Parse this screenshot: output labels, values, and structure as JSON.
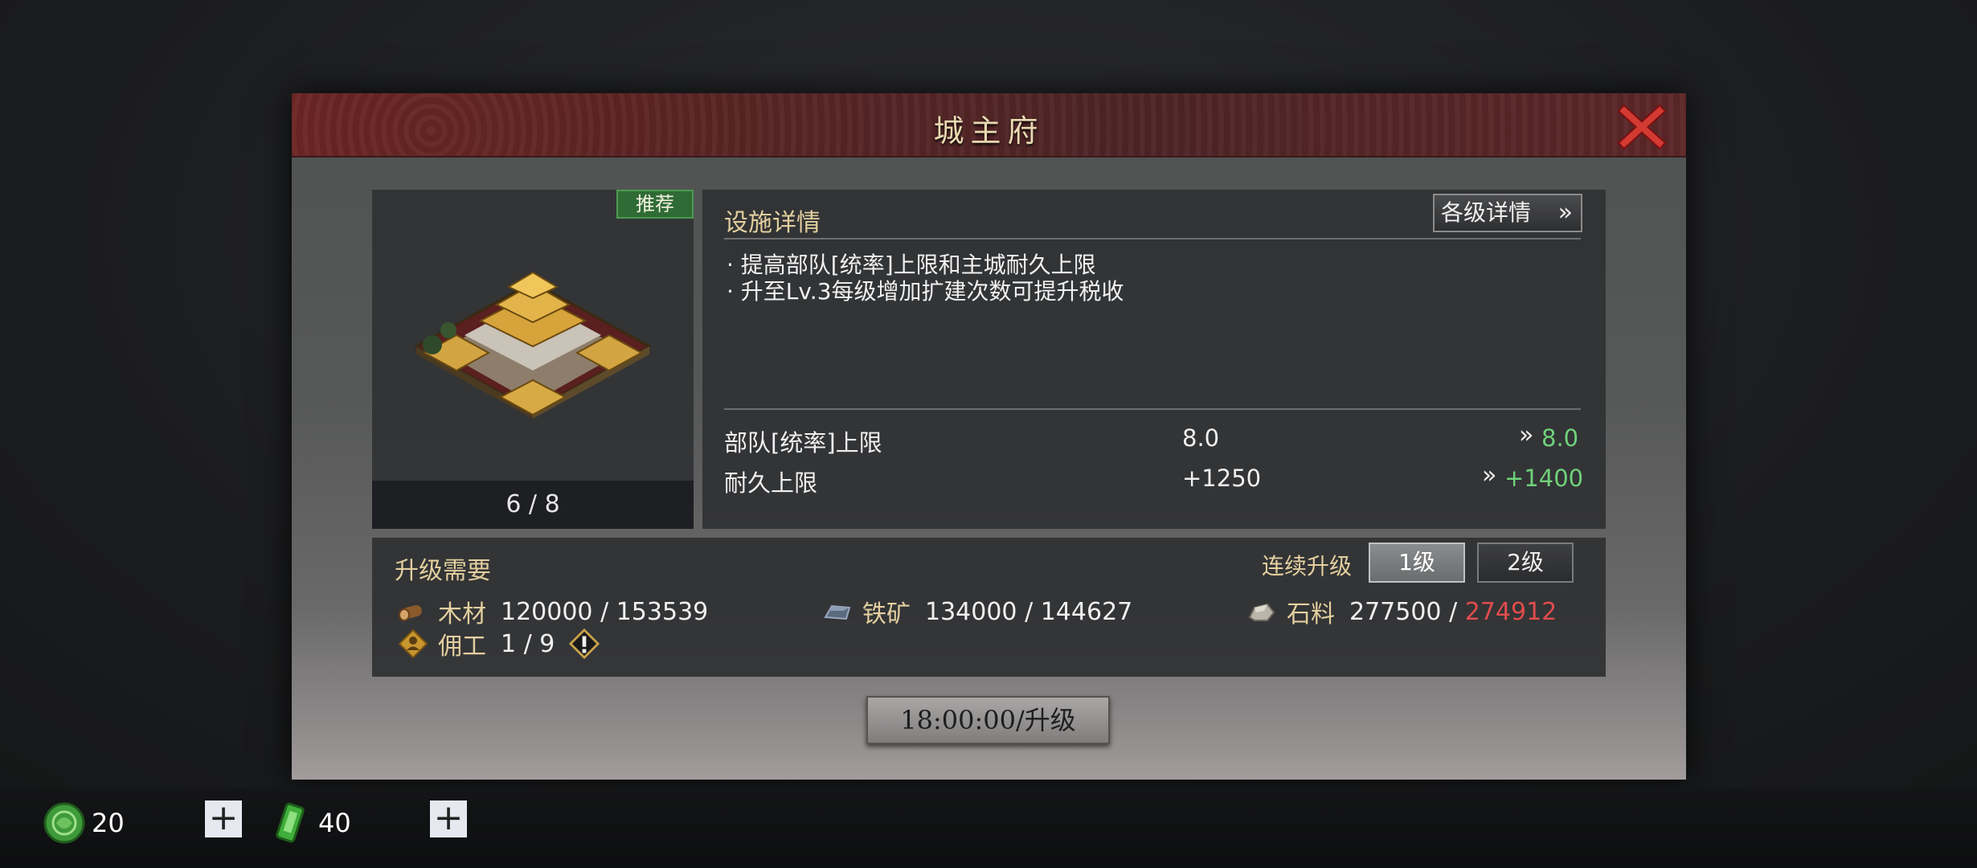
{
  "dialog": {
    "title": "城主府",
    "recommend_badge": "推荐",
    "level": "6 / 8"
  },
  "details": {
    "title": "设施详情",
    "all_levels_button": "各级详情",
    "lines": [
      "· 提高部队[统率]上限和主城耐久上限",
      "· 升至Lv.3每级增加扩建次数可提升税收"
    ],
    "stats": [
      {
        "label": "部队[统率]上限",
        "current": "8.0",
        "next": "8.0"
      },
      {
        "label": "耐久上限",
        "current": "+1250",
        "next": "+1400"
      }
    ]
  },
  "requirements": {
    "title": "升级需要",
    "continuous_label": "连续升级",
    "level1_button": "1级",
    "level2_button": "2级",
    "wood": {
      "name": "木材",
      "required": "120000",
      "owned": "153539"
    },
    "iron": {
      "name": "铁矿",
      "required": "134000",
      "owned": "144627"
    },
    "stone": {
      "name": "石料",
      "required": "277500",
      "owned": "274912"
    },
    "workers": {
      "name": "佣工",
      "value": "1 / 9"
    }
  },
  "upgrade_button": "18:00:00/升级",
  "currencies": [
    {
      "icon": "jade-icon",
      "value": "20"
    },
    {
      "icon": "token-icon",
      "value": "40"
    }
  ],
  "colors": {
    "bonus_green": "#6fd27a",
    "insufficient_red": "#e04c4c",
    "gold_label": "#e3cf9f"
  }
}
